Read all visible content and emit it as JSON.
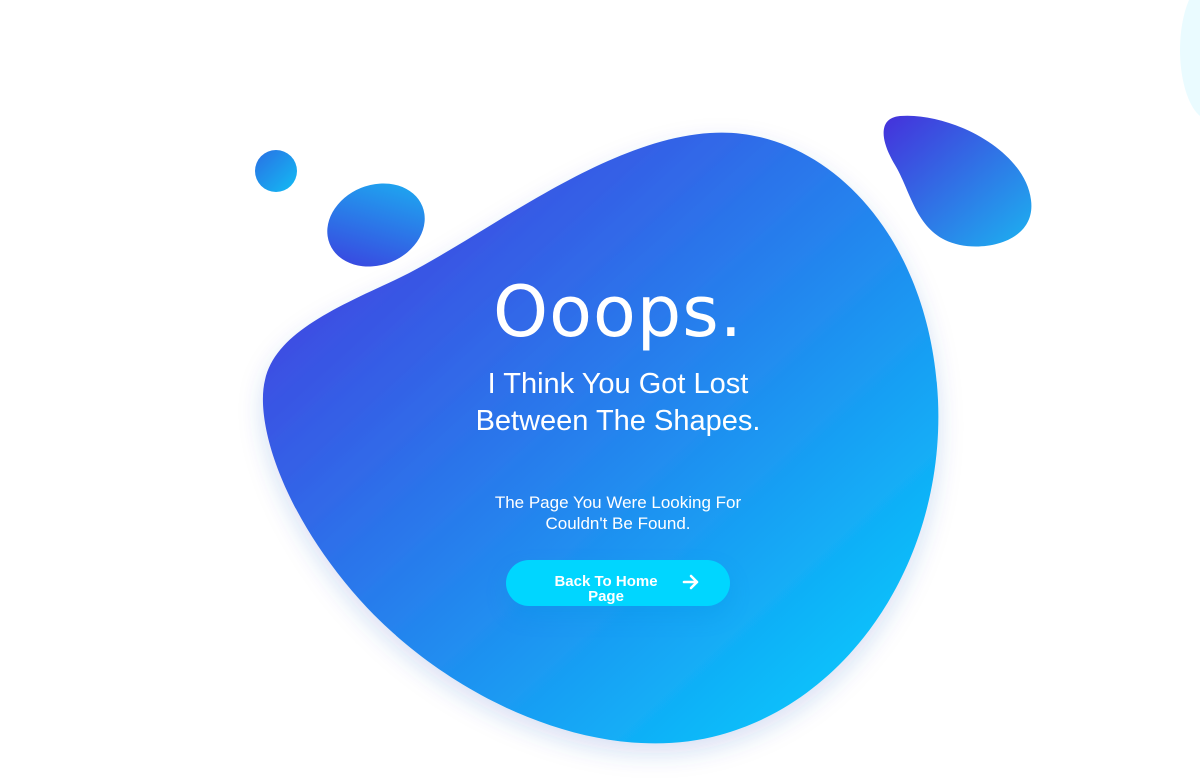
{
  "error": {
    "headline": "Ooops.",
    "subtitle_line1": "I Think You Got Lost",
    "subtitle_line2": "Between The Shapes.",
    "message_line1": "The Page You Were Looking For",
    "message_line2": "Couldn't Be Found."
  },
  "button": {
    "label": "Back To Home Page",
    "icon": "arrow-right-icon"
  },
  "colors": {
    "gradient_start": "#4a2fdc",
    "gradient_end": "#00d6ff",
    "button": "#00d6ff",
    "text": "#ffffff",
    "background": "#ffffff"
  }
}
